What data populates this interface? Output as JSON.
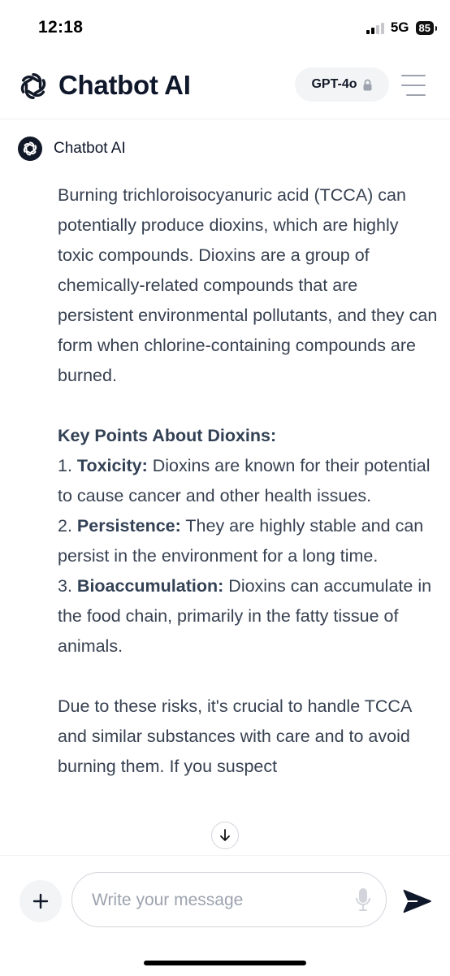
{
  "status": {
    "time": "12:18",
    "network": "5G",
    "battery": "85"
  },
  "header": {
    "title": "Chatbot AI",
    "model": "GPT-4o"
  },
  "bot": {
    "name": "Chatbot AI"
  },
  "message": {
    "intro": "Burning trichloroisocyanuric acid (TCCA) can potentially produce dioxins, which are highly toxic compounds. Dioxins are a group of chemically-related compounds that are persistent environmental pollutants, and they can form when chlorine-containing compounds are burned.",
    "heading": "Key Points About Dioxins:",
    "points": [
      {
        "num": "1.",
        "title": "Toxicity:",
        "text": "Dioxins are known for their potential to cause cancer and other health issues."
      },
      {
        "num": "2.",
        "title": "Persistence:",
        "text": "They are highly stable and can persist in the environment for a long time."
      },
      {
        "num": "3.",
        "title": "Bioaccumulation:",
        "text": "Dioxins can accumulate in the food chain, primarily in the fatty tissue of animals."
      }
    ],
    "closing": "Due to these risks, it's crucial to handle TCCA and similar substances with care and to avoid burning them. If you suspect"
  },
  "composer": {
    "placeholder": "Write your message"
  },
  "icons": {
    "logo": "openai-knot-icon",
    "lock": "lock-icon",
    "menu": "hamburger-menu-icon",
    "scroll": "arrow-down-icon",
    "add": "plus-icon",
    "mic": "microphone-icon",
    "send": "send-icon"
  }
}
